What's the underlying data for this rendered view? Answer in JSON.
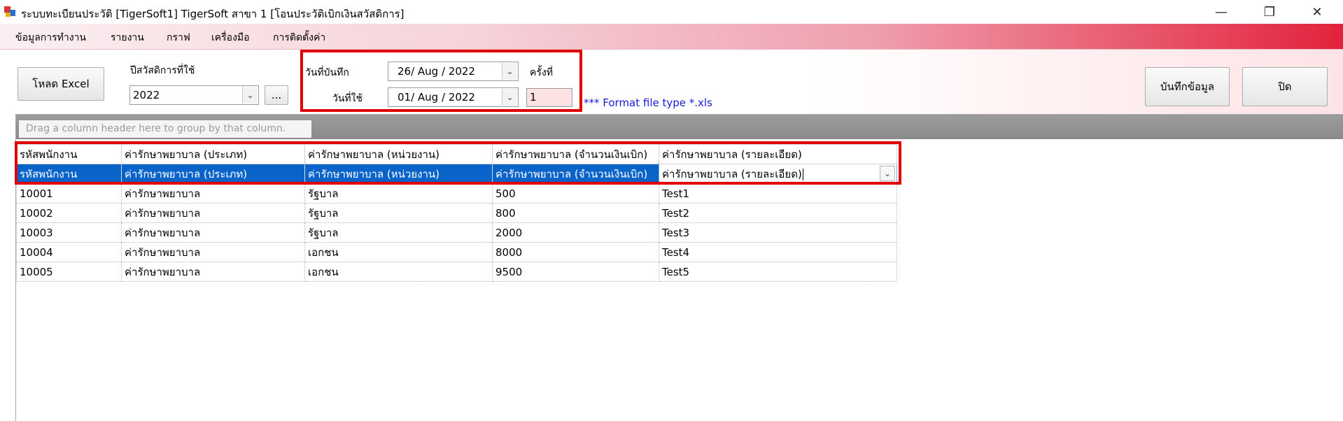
{
  "window": {
    "title": "ระบบทะเบียนประวัติ  [TigerSoft1] TigerSoft สาขา 1  [โอนประวัติเบิกเงินสวัสดิการ]",
    "minimize": "—",
    "maximize": "❐",
    "close": "✕"
  },
  "menu": [
    "ข้อมูลการทำงาน",
    "รายงาน",
    "กราฟ",
    "เครื่องมือ",
    "การติดตั้งค่า"
  ],
  "toolbar": {
    "load_excel": "โหลด Excel",
    "welfare_year_label": "ปีสวัสดิการที่ใช้",
    "welfare_year_value": "2022",
    "browse": "...",
    "record_date_label": "วันที่บันทึก",
    "record_date_value": "26/ Aug  /  2022",
    "use_date_label": "วันที่ใช้",
    "use_date_value": "01/ Aug  /  2022",
    "time_label": "ครั้งที่",
    "time_value": "1",
    "format_note": "*** Format file type *.xls",
    "save": "บันทึกข้อมูล",
    "close": "ปิด"
  },
  "grid": {
    "group_hint": "Drag a column header here to group by that column.",
    "columns": [
      "รหัสพนักงาน",
      "ค่ารักษาพยาบาล (ประเภท)",
      "ค่ารักษาพยาบาล (หน่วยงาน)",
      "ค่ารักษาพยาบาล (จำนวนเงินเบิก)",
      "ค่ารักษาพยาบาล (รายละเอียด)"
    ],
    "mapping_row": [
      "รหัสพนักงาน",
      "ค่ารักษาพยาบาล (ประเภท)",
      "ค่ารักษาพยาบาล (หน่วยงาน)",
      "ค่ารักษาพยาบาล (จำนวนเงินเบิก)",
      "ค่ารักษาพยาบาล (รายละเอียด)"
    ],
    "rows": [
      [
        "10001",
        "ค่ารักษาพยาบาล",
        "รัฐบาล",
        "500",
        "Test1"
      ],
      [
        "10002",
        "ค่ารักษาพยาบาล",
        "รัฐบาล",
        "800",
        "Test2"
      ],
      [
        "10003",
        "ค่ารักษาพยาบาล",
        "รัฐบาล",
        "2000",
        "Test3"
      ],
      [
        "10004",
        "ค่ารักษาพยาบาล",
        "เอกชน",
        "8000",
        "Test4"
      ],
      [
        "10005",
        "ค่ารักษาพยาบาล",
        "เอกชน",
        "9500",
        "Test5"
      ]
    ]
  },
  "icons": {
    "dropdown": "chevron-down-icon"
  },
  "colors": {
    "menu_accent": "#e3223d",
    "selection": "#0a63c9",
    "highlight_box": "#e00000",
    "note": "#1a1adc"
  }
}
